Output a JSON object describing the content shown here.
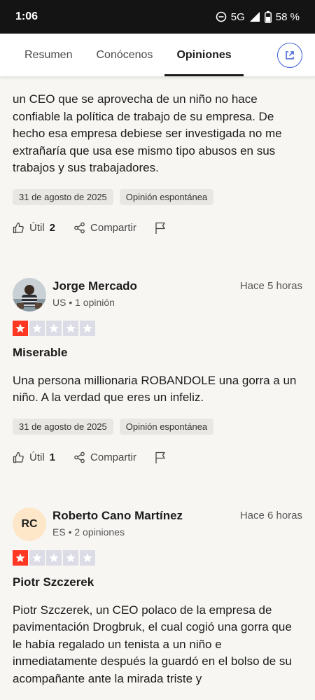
{
  "status": {
    "time": "1:06",
    "network": "5G",
    "battery": "58 %"
  },
  "tabs": [
    {
      "label": "Resumen"
    },
    {
      "label": "Conócenos"
    },
    {
      "label": "Opiniones"
    }
  ],
  "reviews": [
    {
      "text": "un CEO que se aprovecha de un niño no hace confiable la política de trabajo de su empresa. De hecho esa empresa debiese ser investigada no me extrañaría que usa ese mismo tipo abusos en sus trabajos y sus trabajadores.",
      "date": "31 de agosto de 2025",
      "tag": "Opinión espontánea",
      "useful_label": "Útil",
      "useful_count": "2",
      "share_label": "Compartir"
    },
    {
      "name": "Jorge Mercado",
      "meta": "US • 1 opinión",
      "time_ago": "Hace 5 horas",
      "rating": 1,
      "title": "Miserable",
      "text": "Una persona millionaria ROBANDOLE una gorra a un niño. A la verdad que eres un infeliz.",
      "date": "31 de agosto de 2025",
      "tag": "Opinión espontánea",
      "useful_label": "Útil",
      "useful_count": "1",
      "share_label": "Compartir"
    },
    {
      "name": "Roberto Cano Martínez",
      "initials": "RC",
      "meta": "ES • 2 opiniones",
      "time_ago": "Hace 6 horas",
      "rating": 1,
      "title": "Piotr Szczerek",
      "text": "Piotr Szczerek, un CEO polaco de la empresa de pavimentación Drogbruk, el cual cogió una gorra que le había regalado un tenista a un niño e inmediatamente después la guardó en el bolso de su acompañante ante la mirada triste y"
    }
  ],
  "colors": {
    "star_on": "#ff3722",
    "star_off": "#dcdce6",
    "link_blue": "#3c5fd7"
  }
}
